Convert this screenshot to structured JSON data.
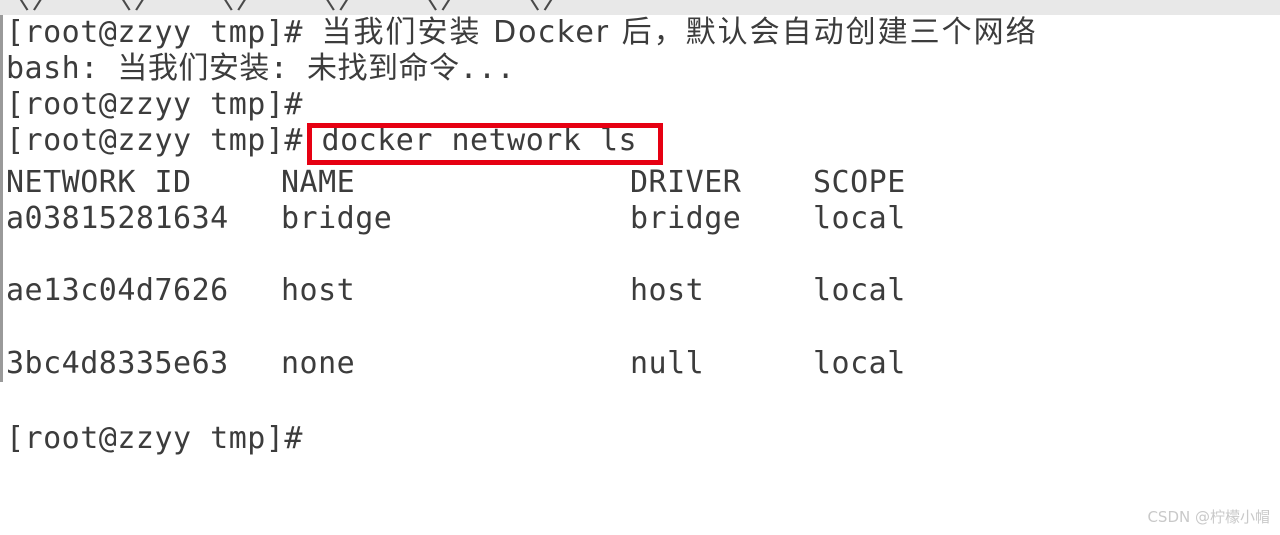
{
  "terminal": {
    "prompt": "[root@zzyy tmp]# ",
    "top_partial_line": "〈〉  〈〉  〈〉  〈〉  〈〉  〈〉",
    "lines": [
      {
        "id": "line-1",
        "prompt": "[root@zzyy tmp]# ",
        "command": "当我们安装 Docker 后，默认会自动创建三个网络",
        "type": "prompt-command"
      },
      {
        "id": "line-2",
        "text": "bash: 当我们安装: 未找到命令...",
        "type": "output"
      },
      {
        "id": "line-3",
        "prompt": "[root@zzyy tmp]# ",
        "command": "",
        "type": "prompt-empty"
      },
      {
        "id": "line-4",
        "prompt": "[root@zzyy tmp]# ",
        "command": "docker network ls",
        "type": "prompt-command",
        "highlighted": true
      }
    ],
    "final_prompt": "[root@zzyy tmp]# "
  },
  "table": {
    "headers": [
      "NETWORK ID",
      "NAME",
      "DRIVER",
      "SCOPE"
    ],
    "rows": [
      {
        "network_id": "a03815281634",
        "name": "bridge",
        "driver": "bridge",
        "scope": "local"
      },
      {
        "network_id": "ae13c04d7626",
        "name": "host",
        "driver": "host",
        "scope": "local"
      },
      {
        "network_id": "3bc4d8335e63",
        "name": "none",
        "driver": "null",
        "scope": "local"
      }
    ]
  },
  "annotation": {
    "highlight_color": "#e60012",
    "highlight_target": "docker network ls"
  },
  "watermark": {
    "text": "CSDN @柠檬小帽"
  }
}
